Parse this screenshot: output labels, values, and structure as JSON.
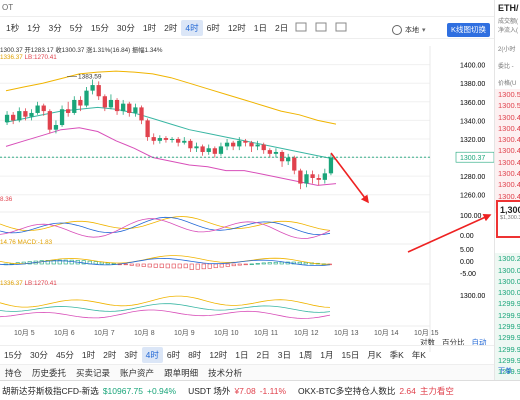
{
  "toolbar": {
    "truncated_left": "OT",
    "timeframes": [
      "1秒",
      "1分",
      "3分",
      "5分",
      "15分",
      "30分",
      "1时",
      "2时",
      "4时",
      "6时",
      "12时",
      "1日",
      "2日"
    ],
    "active_timeframe": "4时",
    "mode_label": "本地",
    "kline_button": "K线图切换"
  },
  "chart_info": {
    "line1": "1300.37 开1283.17 收1300.37 涨1.31%(16.84) 振幅1.34%",
    "ma_label": "1336.37",
    "lb_label": "LB:1270.41",
    "high_label": "1383.59",
    "current_price": "1300.37",
    "macd_label": "14.76  MACD:-1.83",
    "lower_ma_label": "1336.37",
    "lower_lb_label": "LB:1270.41",
    "rsi_label": "8.36"
  },
  "price_axis": [
    "1400.00",
    "1380.00",
    "1360.00",
    "1340.00",
    "1320.00",
    "1300.00",
    "1280.00",
    "1260.00"
  ],
  "osc_axis": [
    "100.00",
    "0.00"
  ],
  "macd_axis": [
    "5.00",
    "0.00",
    "-5.00"
  ],
  "lower_axis": [
    "1300.00"
  ],
  "date_axis": [
    "10月 5",
    "10月 6",
    "10月 7",
    "10月 8",
    "10月 9",
    "10月 10",
    "10月 11",
    "10月 12",
    "10月 13",
    "10月 14",
    "10月 15"
  ],
  "scale_options": [
    "对数",
    "百分比",
    "自动"
  ],
  "bottom_timeframes": [
    "15分",
    "30分",
    "45分",
    "1时",
    "2时",
    "3时",
    "4时",
    "6时",
    "8时",
    "12时",
    "1日",
    "2日",
    "3日",
    "1周",
    "1月",
    "15日",
    "月K",
    "季K",
    "年K"
  ],
  "bottom_active": "4时",
  "tabs": [
    "持仓",
    "历史委托",
    "买卖记录",
    "账户资产",
    "跟单明细",
    "技术分析"
  ],
  "ticker": [
    {
      "name": "胡新达芬斯极指CFD-新选",
      "price": "$10967.75",
      "change": "+0.94%",
      "dir": "up"
    },
    {
      "name": "USDT 场外",
      "price": "¥7.08",
      "change": "-1.11%",
      "dir": "down"
    },
    {
      "name": "OKX-BTC多空持仓人数比",
      "price": "2.64",
      "change": "主力看空",
      "dir": "down"
    },
    {
      "name": "",
      "price": "",
      "change": "",
      "dir": "up"
    }
  ],
  "right_panel": {
    "symbol": "ETH/",
    "subtitle1": "成交额(",
    "subtitle2": "净流入(",
    "label_2h": "2(小时",
    "label_change": "委比 -",
    "label_price": "价格(U",
    "asks": [
      "1300.5",
      "1300.5",
      "1300.4",
      "1300.4",
      "1300.4",
      "1300.4",
      "1300.4",
      "1300.4",
      "1300.4",
      "1300.4",
      "1300.3"
    ],
    "mid_price": "1,300",
    "mid_sub": "$1,300.3",
    "bids": [
      "1300.2",
      "1300.0",
      "1300.0",
      "1300.0",
      "1299.9",
      "1299.9",
      "1299.9",
      "1299.9",
      "1299.9",
      "1299.9",
      "1299.9",
      "1299.8",
      "1299.8"
    ],
    "bottom": "下单"
  },
  "chart_data": {
    "type": "candlestick",
    "y_range": [
      1250,
      1405
    ],
    "candles": [
      {
        "o": 1338,
        "c": 1346,
        "h": 1350,
        "l": 1335
      },
      {
        "o": 1346,
        "c": 1340,
        "h": 1349,
        "l": 1336
      },
      {
        "o": 1340,
        "c": 1350,
        "h": 1354,
        "l": 1338
      },
      {
        "o": 1350,
        "c": 1344,
        "h": 1353,
        "l": 1340
      },
      {
        "o": 1344,
        "c": 1348,
        "h": 1352,
        "l": 1340
      },
      {
        "o": 1348,
        "c": 1356,
        "h": 1360,
        "l": 1346
      },
      {
        "o": 1356,
        "c": 1350,
        "h": 1358,
        "l": 1345
      },
      {
        "o": 1350,
        "c": 1330,
        "h": 1352,
        "l": 1326
      },
      {
        "o": 1330,
        "c": 1335,
        "h": 1340,
        "l": 1326
      },
      {
        "o": 1335,
        "c": 1352,
        "h": 1356,
        "l": 1333
      },
      {
        "o": 1352,
        "c": 1348,
        "h": 1360,
        "l": 1344
      },
      {
        "o": 1348,
        "c": 1362,
        "h": 1366,
        "l": 1346
      },
      {
        "o": 1362,
        "c": 1356,
        "h": 1366,
        "l": 1350
      },
      {
        "o": 1356,
        "c": 1372,
        "h": 1376,
        "l": 1354
      },
      {
        "o": 1372,
        "c": 1378,
        "h": 1384,
        "l": 1368
      },
      {
        "o": 1378,
        "c": 1366,
        "h": 1382,
        "l": 1362
      },
      {
        "o": 1366,
        "c": 1354,
        "h": 1368,
        "l": 1350
      },
      {
        "o": 1354,
        "c": 1362,
        "h": 1368,
        "l": 1352
      },
      {
        "o": 1362,
        "c": 1350,
        "h": 1364,
        "l": 1346
      },
      {
        "o": 1350,
        "c": 1358,
        "h": 1362,
        "l": 1346
      },
      {
        "o": 1358,
        "c": 1348,
        "h": 1360,
        "l": 1344
      },
      {
        "o": 1348,
        "c": 1354,
        "h": 1358,
        "l": 1344
      },
      {
        "o": 1354,
        "c": 1340,
        "h": 1356,
        "l": 1336
      },
      {
        "o": 1340,
        "c": 1322,
        "h": 1342,
        "l": 1318
      },
      {
        "o": 1322,
        "c": 1318,
        "h": 1326,
        "l": 1314
      },
      {
        "o": 1318,
        "c": 1321,
        "h": 1324,
        "l": 1315
      },
      {
        "o": 1321,
        "c": 1319,
        "h": 1323,
        "l": 1316
      },
      {
        "o": 1319,
        "c": 1320,
        "h": 1322,
        "l": 1316
      },
      {
        "o": 1320,
        "c": 1316,
        "h": 1322,
        "l": 1312
      },
      {
        "o": 1316,
        "c": 1318,
        "h": 1322,
        "l": 1314
      },
      {
        "o": 1318,
        "c": 1310,
        "h": 1320,
        "l": 1306
      },
      {
        "o": 1310,
        "c": 1312,
        "h": 1316,
        "l": 1306
      },
      {
        "o": 1312,
        "c": 1306,
        "h": 1314,
        "l": 1302
      },
      {
        "o": 1306,
        "c": 1310,
        "h": 1314,
        "l": 1303
      },
      {
        "o": 1310,
        "c": 1304,
        "h": 1312,
        "l": 1300
      },
      {
        "o": 1304,
        "c": 1312,
        "h": 1316,
        "l": 1302
      },
      {
        "o": 1312,
        "c": 1316,
        "h": 1320,
        "l": 1308
      },
      {
        "o": 1316,
        "c": 1312,
        "h": 1318,
        "l": 1308
      },
      {
        "o": 1312,
        "c": 1318,
        "h": 1322,
        "l": 1308
      },
      {
        "o": 1318,
        "c": 1316,
        "h": 1320,
        "l": 1312
      },
      {
        "o": 1316,
        "c": 1312,
        "h": 1318,
        "l": 1306
      },
      {
        "o": 1312,
        "c": 1314,
        "h": 1318,
        "l": 1308
      },
      {
        "o": 1314,
        "c": 1308,
        "h": 1316,
        "l": 1304
      },
      {
        "o": 1308,
        "c": 1304,
        "h": 1310,
        "l": 1300
      },
      {
        "o": 1304,
        "c": 1306,
        "h": 1310,
        "l": 1300
      },
      {
        "o": 1306,
        "c": 1296,
        "h": 1308,
        "l": 1290
      },
      {
        "o": 1296,
        "c": 1300,
        "h": 1304,
        "l": 1292
      },
      {
        "o": 1300,
        "c": 1286,
        "h": 1302,
        "l": 1282
      },
      {
        "o": 1286,
        "c": 1272,
        "h": 1288,
        "l": 1266
      },
      {
        "o": 1272,
        "c": 1282,
        "h": 1286,
        "l": 1268
      },
      {
        "o": 1282,
        "c": 1278,
        "h": 1286,
        "l": 1272
      },
      {
        "o": 1278,
        "c": 1276,
        "h": 1282,
        "l": 1270
      },
      {
        "o": 1276,
        "c": 1283,
        "h": 1288,
        "l": 1272
      },
      {
        "o": 1283,
        "c": 1300,
        "h": 1304,
        "l": 1281
      }
    ],
    "upper_band": [
      1372,
      1376,
      1380,
      1385,
      1390,
      1392,
      1393,
      1392,
      1390,
      1386,
      1380,
      1374,
      1368,
      1362,
      1356,
      1350,
      1346,
      1340,
      1336
    ],
    "mid_band": [
      1338,
      1342,
      1346,
      1350,
      1352,
      1354,
      1352,
      1348,
      1342,
      1336,
      1330,
      1326,
      1322,
      1318,
      1314,
      1310,
      1306,
      1302,
      1298
    ],
    "lower_band": [
      1312,
      1318,
      1324,
      1330,
      1332,
      1328,
      1318,
      1310,
      1300,
      1296,
      1292,
      1290,
      1286,
      1286,
      1282,
      1278,
      1274,
      1270,
      1272
    ]
  }
}
